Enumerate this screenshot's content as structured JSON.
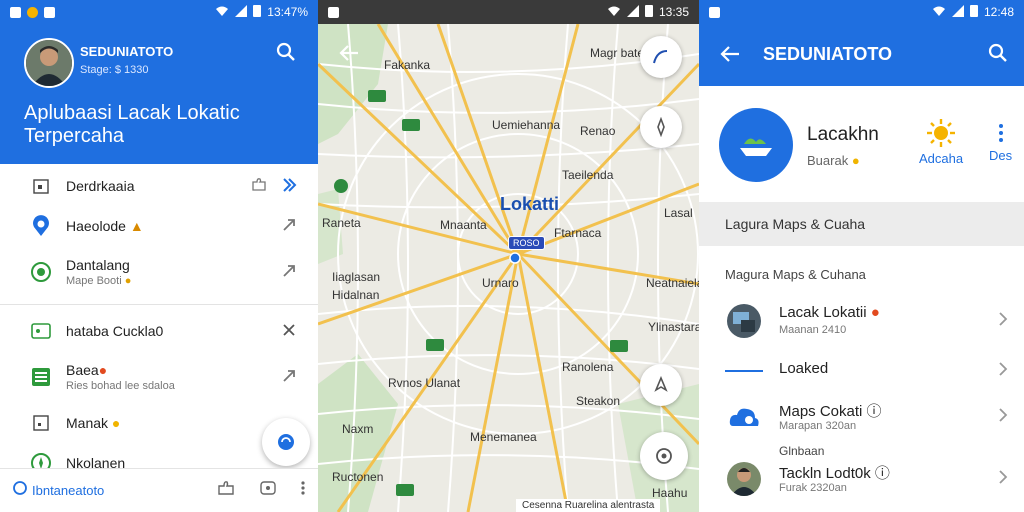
{
  "panel1": {
    "status_time": "13:47%",
    "user_name": "SEDUNIATOTO",
    "user_sub": "Stage: $ 1330",
    "header_title": "Aplubaasi Lacak Lokatic Terpercaha",
    "items": [
      {
        "label": "Derdrkaaia",
        "sub": ""
      },
      {
        "label": "Haeolode",
        "sub": ""
      },
      {
        "label": "Dantalang",
        "sub": "Mape Booti"
      },
      {
        "label": "hataba Cuckla0",
        "sub": ""
      },
      {
        "label": "Baea",
        "sub": "Ries bohad lee sdaloa"
      },
      {
        "label": "Manak",
        "sub": ""
      },
      {
        "label": "Nkolanen",
        "sub": ""
      }
    ],
    "bottom_label": "Ibntaneatoto"
  },
  "panel2": {
    "status_time": "13:35",
    "center_title": "Lokatti",
    "center_pin": "ROSO",
    "labels": [
      "Fakanka",
      "Magr batee",
      "Uemiehanna",
      "Renao",
      "Taeilenda",
      "Mnaanta",
      "Iiaglasan",
      "Urnaro",
      "Raneta",
      "Ftarnaca",
      "Neatnaiela",
      "Hidalnan",
      "Lasal",
      "Rvnos Ulanat",
      "Ranolena",
      "Steakon",
      "Naxm",
      "Menemanea",
      "Ylinastara",
      "Ructonen",
      "Haahu"
    ],
    "attribution": "Cesenna Ruarelina alentrasta"
  },
  "panel3": {
    "status_time": "12:48",
    "title": "SEDUNIATOTO",
    "app_name": "Lacakhn",
    "app_sub": "Buarak",
    "action1": "Adcaha",
    "action2": "Des",
    "section_bar": "Lagura Maps & Cuaha",
    "section_label": "Magura Maps & Cuhana",
    "rows": [
      {
        "label": "Lacak Lokatii",
        "sub": "Maanan 2410"
      },
      {
        "label": "Loaked",
        "sub": ""
      },
      {
        "label": "Maps Cokati",
        "sub": "Marapan 320an"
      },
      {
        "label": "Tackln Lodt0k",
        "sub": "Furak 2320an",
        "top": "Glnbaan"
      }
    ]
  }
}
